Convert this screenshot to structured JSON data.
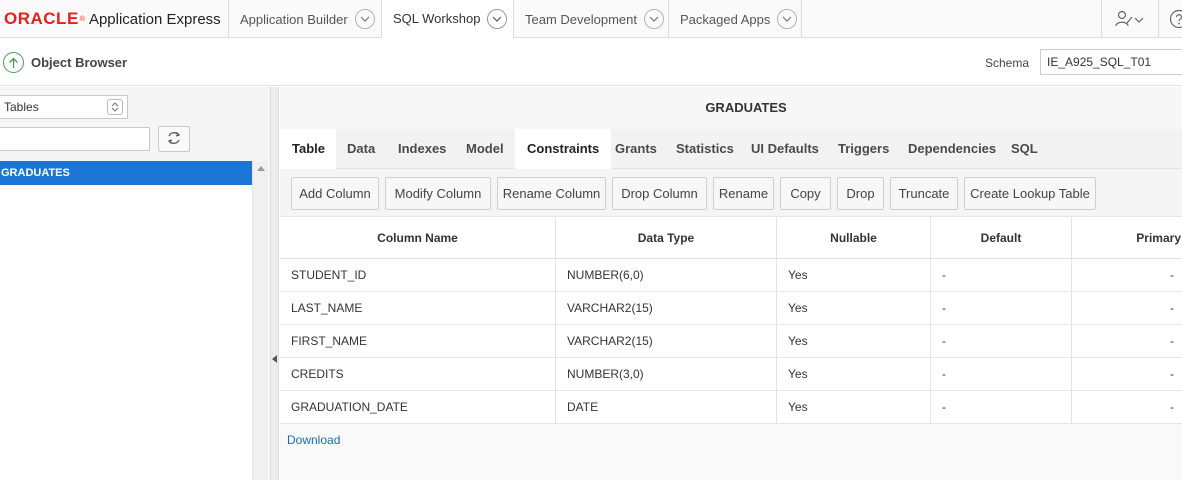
{
  "brand": {
    "oracle": "ORACLE",
    "reg": "®",
    "product": "Application Express"
  },
  "nav": {
    "tabs": [
      {
        "label": "Application Builder"
      },
      {
        "label": "SQL Workshop"
      },
      {
        "label": "Team Development"
      },
      {
        "label": "Packaged Apps"
      }
    ],
    "active_tab": "SQL Workshop"
  },
  "page": {
    "title": "Object Browser",
    "schema_label": "Schema",
    "schema_value": "IE_A925_SQL_T01"
  },
  "left": {
    "object_type": "Tables",
    "filter_value": "",
    "items": [
      {
        "label": "GRADUATES",
        "selected": true
      }
    ]
  },
  "object": {
    "name": "GRADUATES",
    "tabs": [
      "Table",
      "Data",
      "Indexes",
      "Model",
      "Constraints",
      "Grants",
      "Statistics",
      "UI Defaults",
      "Triggers",
      "Dependencies",
      "SQL"
    ],
    "active_tab": "Constraints",
    "buttons": [
      "Add Column",
      "Modify Column",
      "Rename Column",
      "Drop Column",
      "Rename",
      "Copy",
      "Drop",
      "Truncate",
      "Create Lookup Table"
    ],
    "columns": [
      "Column Name",
      "Data Type",
      "Nullable",
      "Default",
      "Primary"
    ],
    "rows": [
      [
        "STUDENT_ID",
        "NUMBER(6,0)",
        "Yes",
        "-",
        "-"
      ],
      [
        "LAST_NAME",
        "VARCHAR2(15)",
        "Yes",
        "-",
        "-"
      ],
      [
        "FIRST_NAME",
        "VARCHAR2(15)",
        "Yes",
        "-",
        "-"
      ],
      [
        "CREDITS",
        "NUMBER(3,0)",
        "Yes",
        "-",
        "-"
      ],
      [
        "GRADUATION_DATE",
        "DATE",
        "Yes",
        "-",
        "-"
      ]
    ],
    "download_label": "Download"
  },
  "colors": {
    "accent": "#1a76d2",
    "brand_red": "#e2231a",
    "link": "#1a6bb5",
    "up_icon": "#4a9a5a"
  },
  "icons": [
    "chevron-down-icon",
    "user-settings-icon",
    "help-icon",
    "up-arrow-icon",
    "stepper-icon",
    "refresh-icon"
  ]
}
